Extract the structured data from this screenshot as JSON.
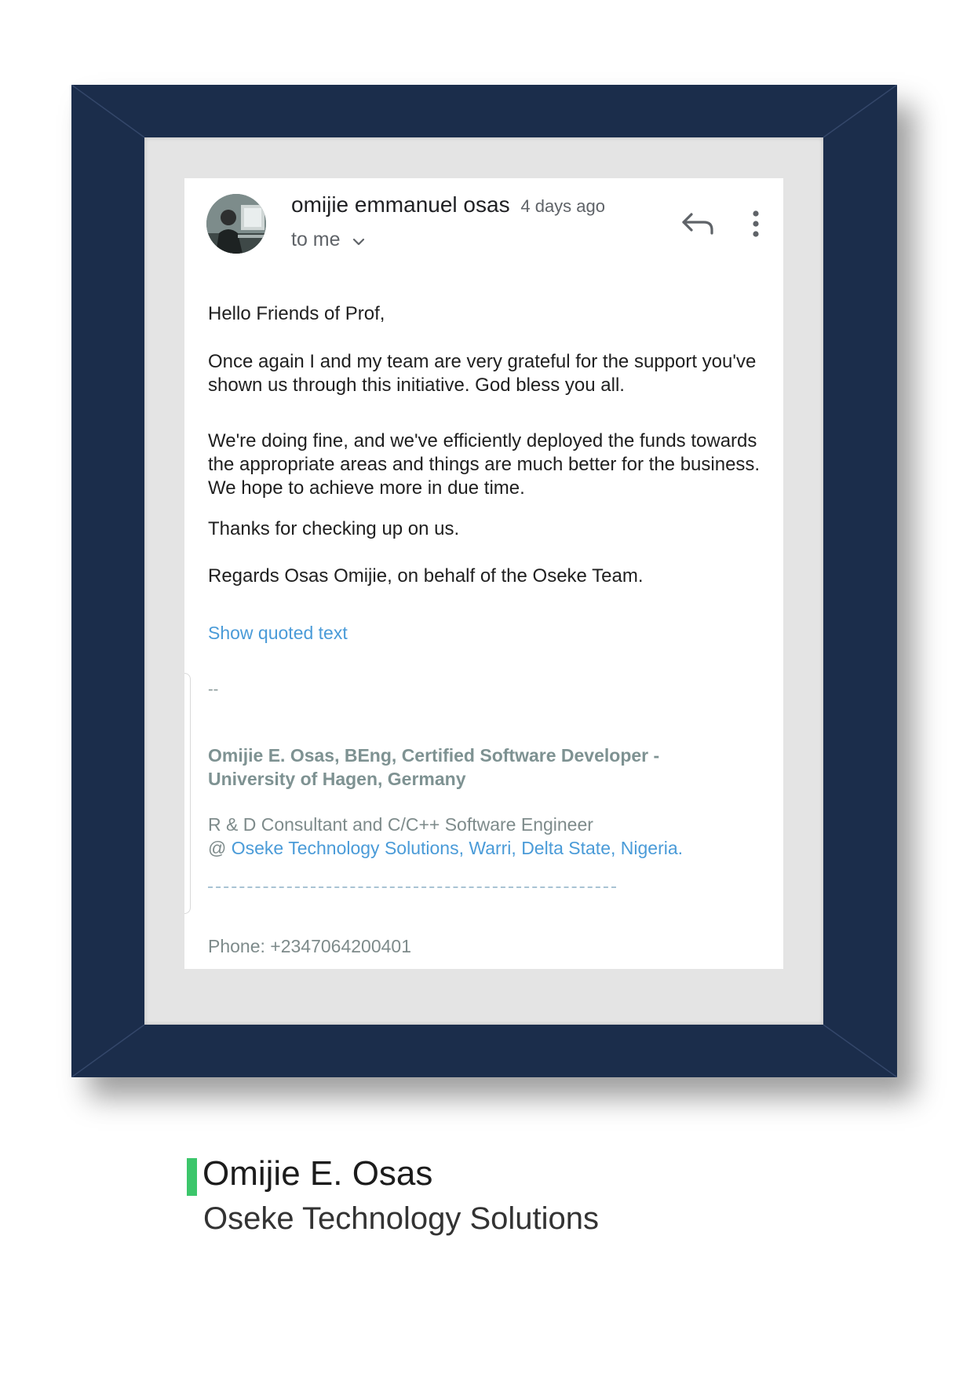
{
  "email": {
    "sender_name": "omijie emmanuel osas",
    "time_ago": "4 days ago",
    "recipient": "to me",
    "greeting": "Hello Friends of Prof,",
    "paragraphs": [
      "Once again I and my team are very grateful for the support you've shown us through this initiative. God bless you all.",
      "We're doing fine, and we've efficiently deployed the funds towards the appropriate areas and things are much better for the business. We hope to achieve more in due time.",
      "Thanks for checking up on us.",
      "Regards Osas Omijie, on behalf of the Oseke Team."
    ],
    "show_quoted": "Show quoted text",
    "signature": {
      "dash": "--",
      "name_line": "Omijie E. Osas, BEng, Certified Software Developer - University of Hagen, Germany",
      "role": "R & D Consultant and C/C++ Software Engineer",
      "at_prefix": "@ ",
      "company_link": "Oseke Technology Solutions, Warri, Delta State, Nigeria.",
      "phone": "Phone: +2347064200401"
    }
  },
  "caption": {
    "name": "Omijie E. Osas",
    "company": "Oseke Technology Solutions"
  },
  "icons": {
    "avatar": "avatar-photo",
    "recipient_toggle": "chevron-down-icon",
    "reply": "reply-icon",
    "more": "more-vert-icon"
  },
  "colors": {
    "frame": "#1b2d4b",
    "mat": "#e4e4e4",
    "link": "#4a9bd8",
    "signature_text": "#7e9292",
    "caption_accent": "#3cc66b"
  }
}
